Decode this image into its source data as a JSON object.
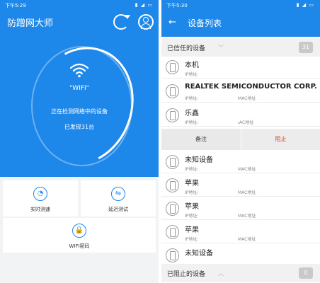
{
  "left": {
    "status": {
      "time": "下午5:29",
      "icons": "▮ ◢ ▭"
    },
    "app_title": "防蹭网大师",
    "scan": {
      "wifi_label": "\"WIFI\"",
      "status_text": "正在检测网络中的设备",
      "found_text": "已发现31台"
    },
    "tools": {
      "speed": {
        "icon": "◔",
        "label": "实时测速"
      },
      "latency": {
        "icon": "⇋",
        "label": "延迟测试"
      },
      "wifi_password": {
        "icon": "🔒",
        "label": "WIFI密码"
      }
    }
  },
  "right": {
    "status": {
      "time": "下午5:30",
      "icons": "▮ ◢ ▭"
    },
    "back_icon": "←",
    "page_title": "设备列表",
    "trusted": {
      "title": "已信任的设备",
      "count": "31",
      "chevron": "﹀"
    },
    "devices": [
      {
        "name": "本机",
        "ip_label": "IP地址:",
        "mac_label": ""
      },
      {
        "name": "REALTEK SEMICONDUCTOR CORP.",
        "ip_label": "IP地址:",
        "mac_label": "MAC地址"
      },
      {
        "name": "乐鑫",
        "ip_label": "IP地址:",
        "mac_label": "ιAC地址"
      },
      {
        "name": "未知设备",
        "ip_label": "IP地址:",
        "mac_label": "MAC地址"
      },
      {
        "name": "苹果",
        "ip_label": "IP地址:",
        "mac_label": "MAC地址"
      },
      {
        "name": "苹果",
        "ip_label": "IP地址:",
        "mac_label": "MAC地址"
      },
      {
        "name": "苹果",
        "ip_label": "IP地址:",
        "mac_label": "MAC地址"
      },
      {
        "name": "未知设备",
        "ip_label": "",
        "mac_label": ""
      }
    ],
    "actions": {
      "note": "备注",
      "block": "阻止"
    },
    "blocked": {
      "title": "已阻止的设备",
      "count": "0",
      "chevron": "︿"
    }
  },
  "colors": {
    "primary": "#1e88ea",
    "danger": "#e33a2e"
  }
}
